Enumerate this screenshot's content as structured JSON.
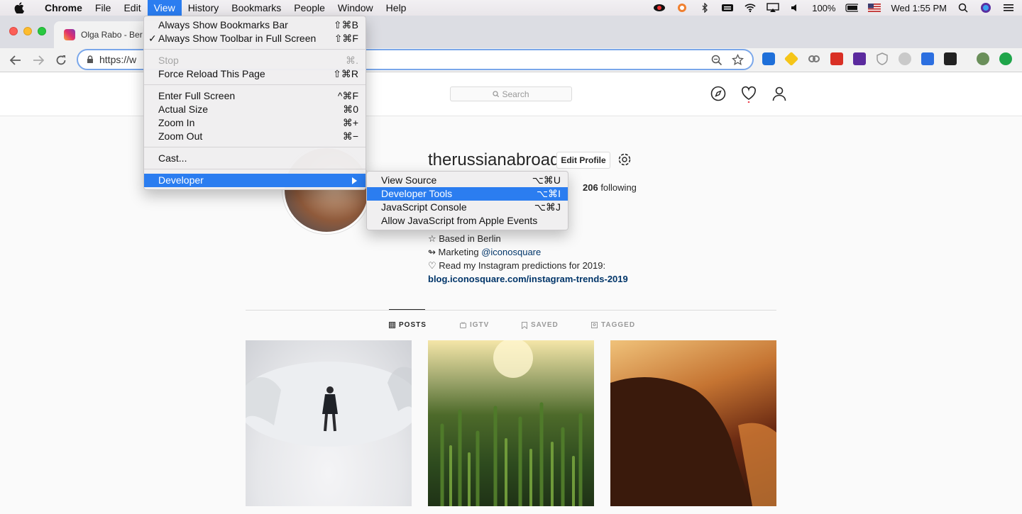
{
  "menubar": {
    "app": "Chrome",
    "items": [
      "File",
      "Edit",
      "View",
      "History",
      "Bookmarks",
      "People",
      "Window",
      "Help"
    ],
    "battery": "100%",
    "clock": "Wed 1:55 PM"
  },
  "tab": {
    "title": "Olga Rabo - Ber"
  },
  "omnibox": {
    "url": "https://w"
  },
  "ig": {
    "search_placeholder": "Search",
    "username": "therussianabroad",
    "edit_profile": "Edit Profile",
    "following_count": "206",
    "following_label": " following",
    "bio": {
      "line1": "☆ Based in Berlin",
      "line2_prefix": "↬ Marketing ",
      "line2_mention": "@iconosquare",
      "line3": "♡ Read my Instagram predictions for 2019:",
      "link": "blog.iconosquare.com/instagram-trends-2019"
    },
    "tabs": [
      "POSTS",
      "IGTV",
      "SAVED",
      "TAGGED"
    ]
  },
  "view_menu": {
    "items": [
      {
        "label": "Always Show Bookmarks Bar",
        "shortcut": "⇧⌘B"
      },
      {
        "label": "Always Show Toolbar in Full Screen",
        "shortcut": "⇧⌘F",
        "check": "✓"
      },
      {
        "label": "Stop",
        "shortcut": "⌘."
      },
      {
        "label": "Force Reload This Page",
        "shortcut": "⇧⌘R"
      },
      {
        "label": "Enter Full Screen",
        "shortcut": "^⌘F"
      },
      {
        "label": "Actual Size",
        "shortcut": "⌘0"
      },
      {
        "label": "Zoom In",
        "shortcut": "⌘+"
      },
      {
        "label": "Zoom Out",
        "shortcut": "⌘−"
      },
      {
        "label": "Cast..."
      },
      {
        "label": "Developer"
      }
    ]
  },
  "dev_menu": {
    "items": [
      {
        "label": "View Source",
        "shortcut": "⌥⌘U"
      },
      {
        "label": "Developer Tools",
        "shortcut": "⌥⌘I"
      },
      {
        "label": "JavaScript Console",
        "shortcut": "⌥⌘J"
      },
      {
        "label": "Allow JavaScript from Apple Events"
      }
    ]
  },
  "colors": {
    "highlight": "#2b7df0",
    "link": "#003569"
  }
}
